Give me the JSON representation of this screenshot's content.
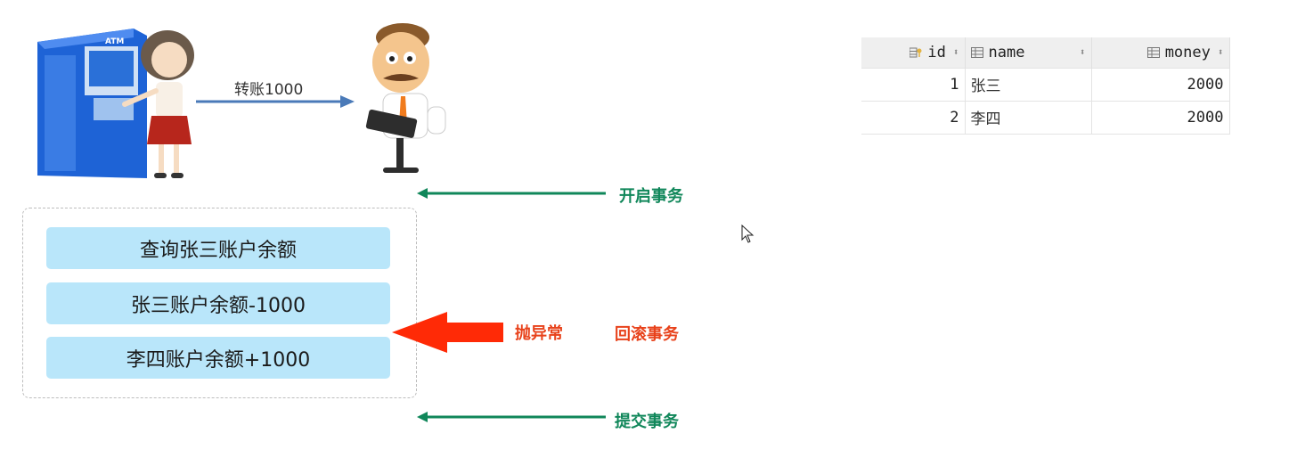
{
  "transfer": {
    "label": "转账1000"
  },
  "steps": [
    {
      "label": "查询张三账户余额"
    },
    {
      "label": "张三账户余额-1000"
    },
    {
      "label": "李四账户余额+1000"
    }
  ],
  "annotations": {
    "begin_transaction": "开启事务",
    "throw_exception": "抛异常",
    "rollback_transaction": "回滚事务",
    "commit_transaction": "提交事务"
  },
  "atm": {
    "sign": "ATM"
  },
  "table": {
    "columns": [
      "id",
      "name",
      "money"
    ],
    "rows": [
      {
        "id": "1",
        "name": "张三",
        "money": "2000"
      },
      {
        "id": "2",
        "name": "李四",
        "money": "2000"
      }
    ]
  },
  "colors": {
    "step_fill": "#b9e6fa",
    "green": "#10875a",
    "red": "#e8421b",
    "blue_arrow": "#4a7ab8"
  }
}
